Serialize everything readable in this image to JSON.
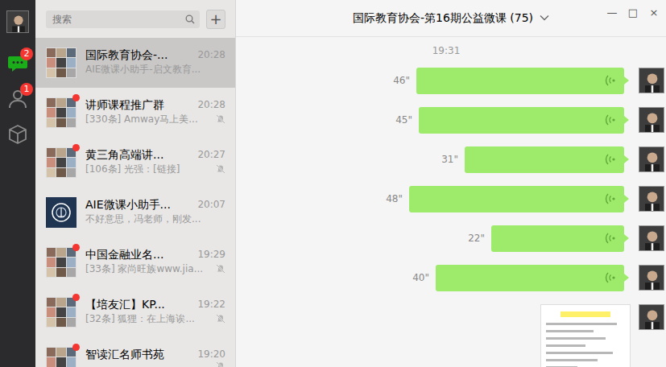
{
  "nav": [
    {
      "badge": "2",
      "selected": true
    },
    {
      "badge": "1",
      "selected": false
    },
    {
      "selected": false
    }
  ],
  "search": {
    "placeholder": "搜索",
    "add": "+"
  },
  "chats": [
    {
      "name": "国际教育协会-...",
      "time": "20:28",
      "preview": "AIE微课小助手-启文教育...",
      "unread": false,
      "muted": false,
      "selected": true,
      "kind": "group"
    },
    {
      "name": "讲师课程推广群",
      "time": "20:28",
      "preview": "[330条] Amway马上美...",
      "unread": true,
      "muted": true,
      "selected": false,
      "kind": "group"
    },
    {
      "name": "黄三角高端讲...",
      "time": "20:27",
      "preview": "[106条] 光强：[链接]",
      "unread": true,
      "muted": true,
      "selected": false,
      "kind": "group"
    },
    {
      "name": "AIE微课小助手...",
      "time": "20:07",
      "preview": "不好意思，冯老师，刚发...",
      "unread": false,
      "muted": false,
      "selected": false,
      "kind": "account"
    },
    {
      "name": "中国金融业名...",
      "time": "19:29",
      "preview": "[33条] 家尚旺族www.jia...",
      "unread": true,
      "muted": true,
      "selected": false,
      "kind": "group"
    },
    {
      "name": "【培友汇】KP...",
      "time": "19:22",
      "preview": "[32条] 狐狸：在上海诶...",
      "unread": true,
      "muted": true,
      "selected": false,
      "kind": "group"
    },
    {
      "name": "智读汇名师书苑",
      "time": "19:20",
      "preview": "",
      "unread": true,
      "muted": true,
      "selected": false,
      "kind": "group"
    }
  ],
  "window": {
    "title": "国际教育协会-第16期公益微课 (75)",
    "controls": [
      "—",
      "□",
      "×"
    ]
  },
  "messages": {
    "time": "19:31",
    "items": [
      {
        "kind": "voice",
        "duration": "46\"",
        "level": 0.86
      },
      {
        "kind": "voice",
        "duration": "45\"",
        "level": 0.85
      },
      {
        "kind": "voice",
        "duration": "31\"",
        "level": 0.66
      },
      {
        "kind": "voice",
        "duration": "48\"",
        "level": 0.89
      },
      {
        "kind": "voice",
        "duration": "22\"",
        "level": 0.55
      },
      {
        "kind": "voice",
        "duration": "40\"",
        "level": 0.78
      },
      {
        "kind": "image"
      }
    ]
  }
}
